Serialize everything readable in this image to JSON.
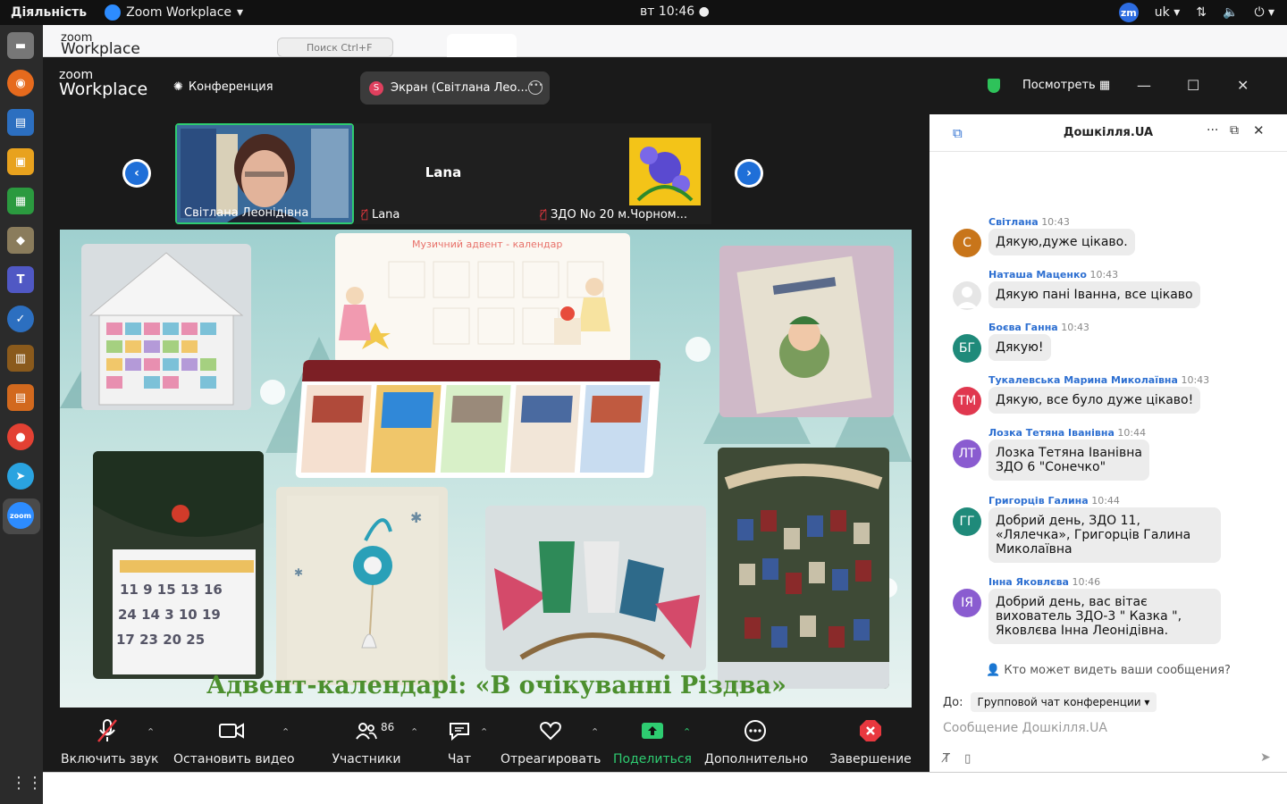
{
  "topbar": {
    "activities": "Діяльність",
    "app_name": "Zoom Workplace",
    "clock": "вт 10:46",
    "zm": "zm",
    "lang": "uk"
  },
  "main_window": {
    "brand_line1": "zoom",
    "brand_line2": "Workplace",
    "search_placeholder": "Поиск Ctrl+F"
  },
  "meeting": {
    "logo_zoom": "zoom",
    "logo_workplace": "Workplace",
    "conference_label": "Конференция",
    "screen_pill": "Экран (Світлана Лео...",
    "view_label": "Посмотреть",
    "thumbnails": [
      {
        "name": "Світлана Леонідівна",
        "muted": false
      },
      {
        "name": "Lana",
        "center_label": "Lana",
        "muted": true
      },
      {
        "name": "ЗДО No 20 м.Чорном...",
        "muted": true
      }
    ],
    "shared_screen": {
      "slide_title_small": "Музичний адвент - календар",
      "caption": "Адвент-календарі: «В очікуванні Різдва»"
    },
    "controls": [
      {
        "id": "mute",
        "label": "Включить звук"
      },
      {
        "id": "video",
        "label": "Остановить видео"
      },
      {
        "id": "participants",
        "label": "Участники",
        "count": "86"
      },
      {
        "id": "chat",
        "label": "Чат"
      },
      {
        "id": "react",
        "label": "Отреагировать"
      },
      {
        "id": "share",
        "label": "Поделиться"
      },
      {
        "id": "more",
        "label": "Дополнительно"
      },
      {
        "id": "end",
        "label": "Завершение"
      }
    ],
    "colors": {
      "share_green": "#2ecc71",
      "end_red": "#e8383f",
      "link_blue": "#2d6fd1"
    }
  },
  "chat": {
    "title": "Дошкілля.UA",
    "messages": [
      {
        "sender": "Світлана",
        "time": "10:43",
        "initials": "С",
        "color": "#c8751a",
        "text": "Дякую,дуже цікаво."
      },
      {
        "sender": "Наташа Маценко",
        "time": "10:43",
        "initials": "",
        "color": "#e6e6e6",
        "text": "Дякую пані Іванна, все цікаво"
      },
      {
        "sender": "Боєва Ганна",
        "time": "10:43",
        "initials": "БГ",
        "color": "#1f8a7a",
        "text": "Дякую!"
      },
      {
        "sender": "Тукалевська Марина Миколаївна",
        "time": "10:43",
        "initials": "ТМ",
        "color": "#e0384f",
        "text": "Дякую, все було дуже цікаво!"
      },
      {
        "sender": "Лозка Тетяна Іванівна",
        "time": "10:44",
        "initials": "ЛТ",
        "color": "#8a5cd0",
        "text_lines": [
          "Лозка Тетяна Іванівна",
          "ЗДО 6 \"Сонечко\""
        ]
      },
      {
        "sender": "Григорців Галина",
        "time": "10:44",
        "initials": "ГГ",
        "color": "#1f8a7a",
        "text_lines": [
          "Добрий день, ЗДО 11,",
          "«Лялечка», Григорців Галина",
          "Миколаївна"
        ]
      },
      {
        "sender": "Інна Яковлєва",
        "time": "10:46",
        "initials": "ІЯ",
        "color": "#8a5cd0",
        "text_lines": [
          "Добрий день,  вас вітає",
          "вихователь ЗДО-3 \" Казка \",",
          "Яковлєва Інна Леонідівна."
        ]
      }
    ],
    "privacy": "Кто может видеть ваши сообщения?",
    "to_label": "До:",
    "to_value": "Групповой чат конференции",
    "compose_placeholder": "Сообщение Дошкілля.UA"
  }
}
